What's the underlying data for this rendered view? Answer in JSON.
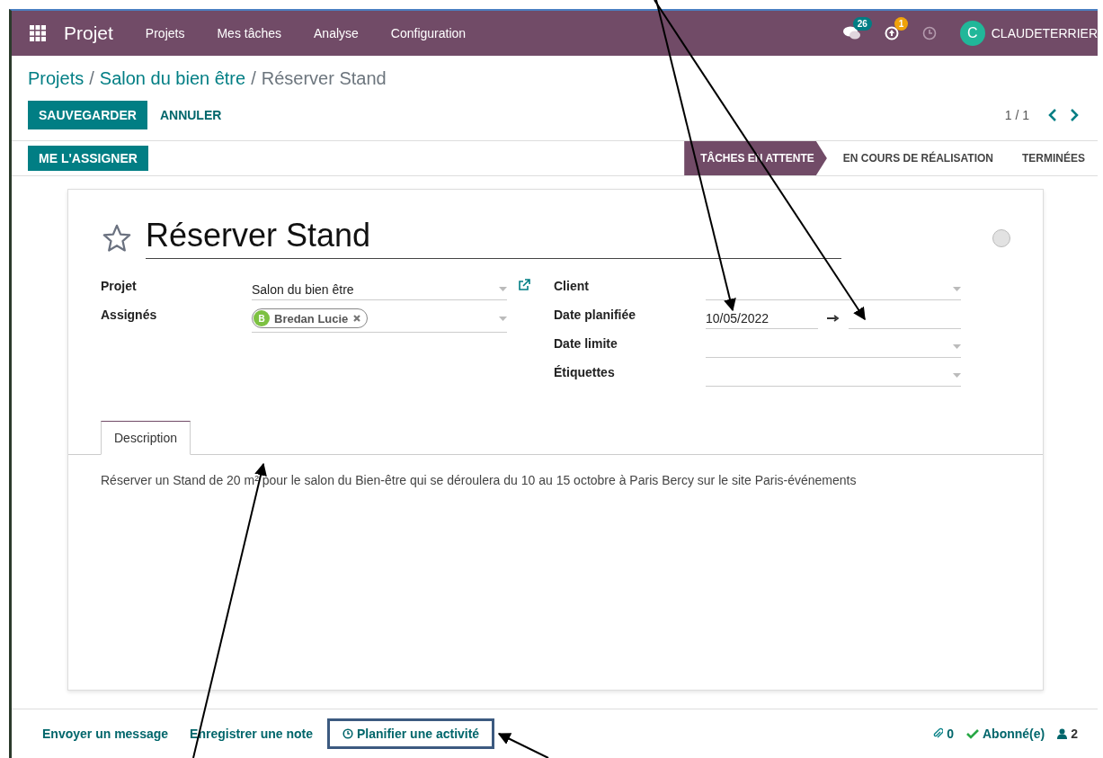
{
  "navbar": {
    "app_title": "Projet",
    "menu": [
      "Projets",
      "Mes tâches",
      "Analyse",
      "Configuration"
    ],
    "messages_count": "26",
    "activities_count": "1",
    "user_initial": "C",
    "user_name": "CLAUDETERRIER"
  },
  "breadcrumb": [
    {
      "label": "Projets"
    },
    {
      "separator": "/",
      "label": "Salon du bien être"
    },
    {
      "separator": "/",
      "label": "Réserver Stand"
    }
  ],
  "buttons": {
    "save": "SAUVEGARDER",
    "discard": "ANNULER",
    "assign": "ME L'ASSIGNER"
  },
  "pager": "1 / 1",
  "stages": [
    {
      "label": "TÂCHES EN ATTENTE",
      "selected": true
    },
    {
      "label": "EN COURS DE RÉALISATION",
      "selected": false
    },
    {
      "label": "TERMINÉES",
      "selected": false
    }
  ],
  "task": {
    "title": "Réserver Stand",
    "starred": false,
    "left_fields": [
      {
        "label": "Projet",
        "value": "Salon du bien être"
      },
      {
        "label": "Assignés",
        "tag": "Bredan Lucie",
        "tag_initial": "B"
      }
    ],
    "right_fields": [
      {
        "label": "Client",
        "kind": "select"
      },
      {
        "label": "Date planifiée",
        "kind": "range",
        "value": "10/05/2022"
      },
      {
        "label": "Date limite",
        "kind": "select"
      },
      {
        "label": "Étiquettes",
        "kind": "select"
      }
    ]
  },
  "notebook": {
    "tabs": [
      {
        "label": "Description",
        "selected": true
      }
    ],
    "description": "Réserver un Stand de 20 m² pour le salon du Bien-être qui se déroulera du 10 au 15 octobre à Paris Bercy sur le site Paris-événements"
  },
  "chatter": {
    "send": "Envoyer un message",
    "note": "Enregistrer une note",
    "schedule": "Planifier une activité",
    "attachments": "0",
    "follow": "Abonné(e)",
    "followers": "2"
  }
}
